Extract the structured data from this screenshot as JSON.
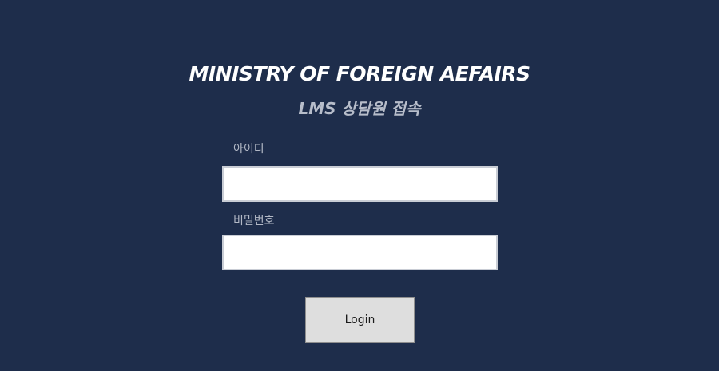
{
  "header": {
    "title": "MINISTRY OF FOREIGN AEFAIRS",
    "subtitle": "LMS 상담원 접속"
  },
  "form": {
    "id_label": "아이디",
    "id_value": "",
    "password_label": "비밀번호",
    "password_value": "",
    "login_label": "Login"
  },
  "colors": {
    "background": "#1e2d4b",
    "title": "#ffffff",
    "subtitle": "#b7bdca",
    "label": "#b3b9c6",
    "input_background": "#ffffff",
    "button_background": "#dedede"
  }
}
